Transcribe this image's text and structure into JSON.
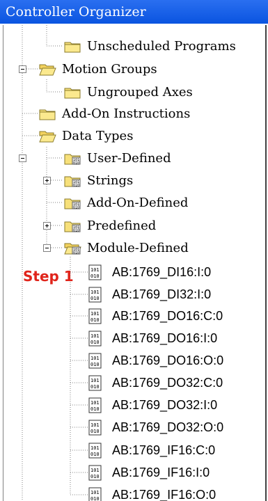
{
  "window": {
    "title": "Controller Organizer"
  },
  "annotation": {
    "text": "Step 1",
    "color": "#e0241b"
  },
  "tree": [
    {
      "label": "Unscheduled Programs",
      "icon": "folder-icon"
    },
    {
      "label": "Motion Groups",
      "icon": "folder-open-icon",
      "expanded": true
    },
    {
      "label": "Ungrouped Axes",
      "icon": "folder-icon"
    },
    {
      "label": "Add-On Instructions",
      "icon": "folder-icon"
    },
    {
      "label": "Data Types",
      "icon": "folder-open-icon",
      "expanded": true
    },
    {
      "label": "User-Defined",
      "icon": "datatype-folder-icon"
    },
    {
      "label": "Strings",
      "icon": "datatype-folder-icon",
      "expanded": false
    },
    {
      "label": "Add-On-Defined",
      "icon": "datatype-folder-icon"
    },
    {
      "label": "Predefined",
      "icon": "datatype-folder-icon",
      "expanded": false
    },
    {
      "label": "Module-Defined",
      "icon": "datatype-folder-open-icon",
      "expanded": true
    }
  ],
  "modules": [
    "AB:1769_DI16:I:0",
    "AB:1769_DI32:I:0",
    "AB:1769_DO16:C:0",
    "AB:1769_DO16:I:0",
    "AB:1769_DO16:O:0",
    "AB:1769_DO32:C:0",
    "AB:1769_DO32:I:0",
    "AB:1769_DO32:O:0",
    "AB:1769_IF16:C:0",
    "AB:1769_IF16:I:0",
    "AB:1769_IF16:O:0"
  ]
}
